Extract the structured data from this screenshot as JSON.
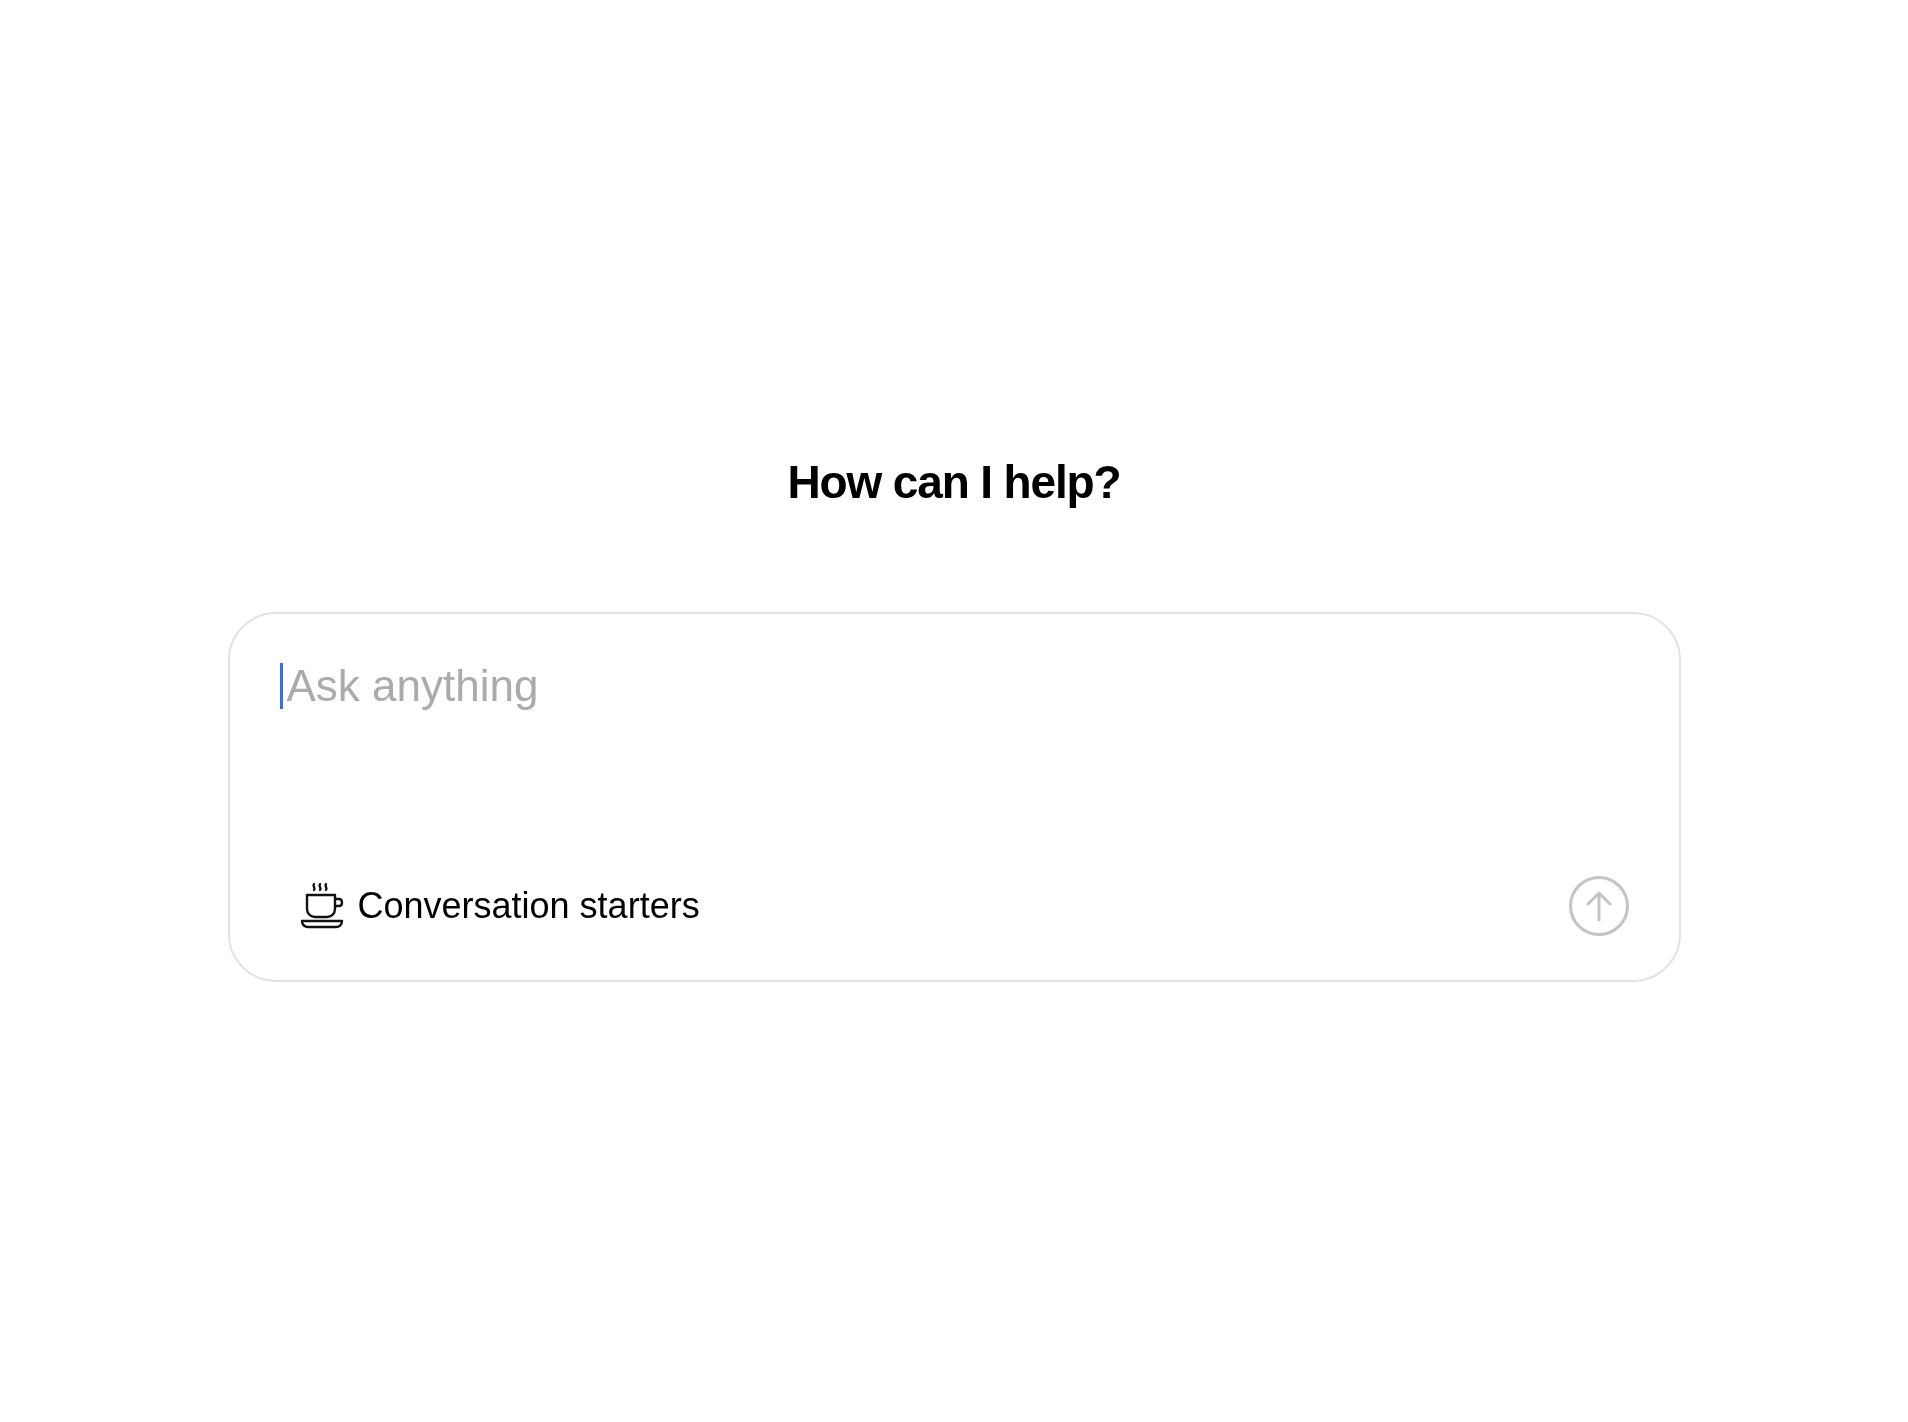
{
  "heading": "How can I help?",
  "prompt": {
    "placeholder": "Ask anything",
    "focused": true
  },
  "starters_button": {
    "label": "Conversation starters"
  },
  "send_button": {
    "disabled": true
  }
}
